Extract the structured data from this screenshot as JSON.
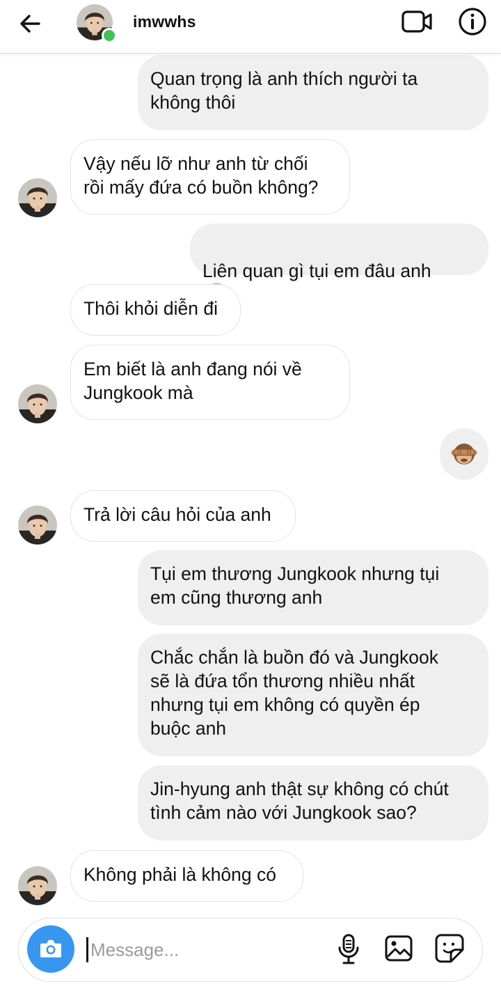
{
  "header": {
    "username": "imwwhs",
    "back_icon": "arrow-left-icon",
    "video_icon": "video-camera-icon",
    "info_icon": "info-icon",
    "online_color": "#3ec45a"
  },
  "messages": [
    {
      "from": "me",
      "text": "Quan trọng là anh thích người ta\nkhông thôi"
    },
    {
      "from": "them",
      "text": "Vậy nếu lỡ như anh từ chối\nrồi mấy đứa có buồn không?"
    },
    {
      "from": "me",
      "text": "Liên quan gì tụi em đâu anh",
      "emoji": "flushed-face"
    },
    {
      "from": "them",
      "text": "Thôi khỏi diễn đi"
    },
    {
      "from": "them",
      "text": "Em biết là anh đang nói về\nJungkook mà"
    },
    {
      "from": "me",
      "emoji": "see-no-evil-monkey"
    },
    {
      "from": "them",
      "text": "Trả lời câu hỏi của anh"
    },
    {
      "from": "me",
      "text": "Tụi em thương Jungkook nhưng tụi\nem cũng thương anh"
    },
    {
      "from": "me",
      "text": "Chắc chắn là buồn đó và Jungkook\nsẽ là đứa tổn thương nhiều nhất\nnhưng tụi em không có quyền ép\nbuộc anh"
    },
    {
      "from": "me",
      "text": "Jin-hyung anh thật sự không có chút\ntình cảm nào với Jungkook sao?"
    },
    {
      "from": "them",
      "text": "Không phải là không có"
    }
  ],
  "composer": {
    "placeholder": "Message...",
    "camera_icon": "camera-icon",
    "mic_icon": "microphone-icon",
    "gallery_icon": "image-gallery-icon",
    "sticker_icon": "sticker-icon",
    "camera_color": "#3797f0"
  }
}
